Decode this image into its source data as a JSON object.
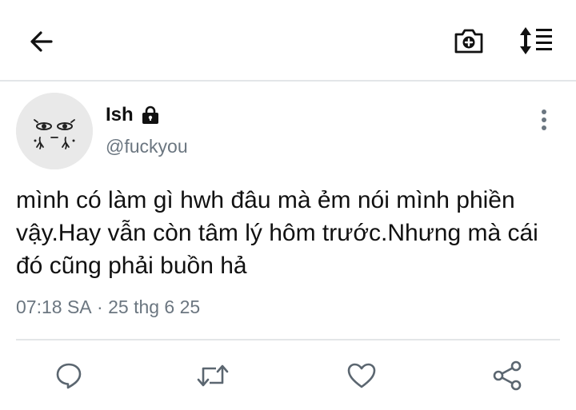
{
  "header": {
    "back_icon": "arrow-left-icon",
    "camera_icon": "camera-plus-icon",
    "sort_icon": "sort-menu-icon"
  },
  "tweet": {
    "display_name": "Ish",
    "lock_icon": "lock-icon",
    "handle": "@fuckyou",
    "more_icon": "more-vertical-icon",
    "text": "mình có làm gì hwh đâu mà ẻm nói mình phiền vậy.Hay vẫn còn tâm lý hôm trước.Nhưng mà cái đó cũng phải buồn hả",
    "time": "07:18 SA",
    "separator": " · ",
    "date": "25 thg 6 25"
  },
  "actions": {
    "reply_icon": "reply-bubble-icon",
    "retweet_icon": "retweet-icon",
    "like_icon": "heart-icon",
    "share_icon": "share-icon"
  },
  "colors": {
    "text_primary": "#111111",
    "text_secondary": "#6b7680",
    "divider": "#e3e6e8",
    "icon_gray": "#5b6670"
  }
}
